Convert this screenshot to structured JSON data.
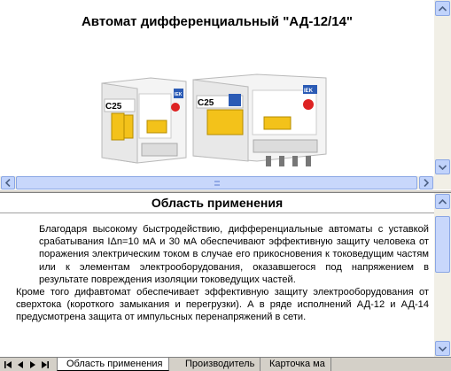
{
  "top": {
    "title": "Автомат дифференциальный \"АД-12/14\"",
    "photo_labels": [
      "C25",
      "C25"
    ],
    "brand": "IEK"
  },
  "bottom": {
    "section_title": "Область применения",
    "paragraphs": [
      "Благодаря высокому быстродействию, дифференциальные автоматы с уставкой срабатывания IΔn=10 мА и 30 мА обеспечивают эффективную защиту человека от поражения электрическим током в случае его прикосновения к токоведущим частям или к элементам электрооборудования, оказавшегося под напряжением в результате повреждения изоляции токоведущих частей.",
      "Кроме того дифавтомат обеспечивает эффективную защиту электрооборудования от сверхтока (короткого замыкания и перегрузки). А в ряде исполнений АД-12 и АД-14 предусмотрена защита от импульсных перенапряжений в сети."
    ]
  },
  "tabs": [
    {
      "label": "Область применения"
    },
    {
      "label": "Производитель"
    },
    {
      "label": "Карточка ма"
    }
  ],
  "colors": {
    "scroll_button": "#c1d3fb",
    "scroll_track": "#f1efe6",
    "breaker_body": "#f4f4f4",
    "toggle": "#f3c21a",
    "test_button": "#2b5bb5"
  }
}
